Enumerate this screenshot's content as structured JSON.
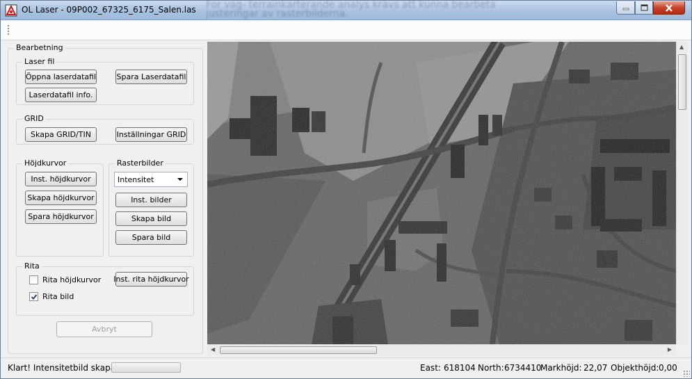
{
  "window": {
    "title": "OL Laser - 09P002_67325_6175_Salen.las",
    "background_text_line1": "För väg- terrainkarterande analys krävs att kunna bearbeta",
    "background_text_line2": "justeringar av rasterbilderna."
  },
  "panel": {
    "group_title": "Bearbetning",
    "laserfil": {
      "title": "Laser fil",
      "open_label": "Öppna laserdatafil",
      "save_label": "Spara Laserdatafil",
      "info_label": "Laserdatafil info."
    },
    "grid": {
      "title": "GRID",
      "create_label": "Skapa GRID/TIN",
      "settings_label": "Inställningar GRID"
    },
    "hojdkurvor": {
      "title": "Höjdkurvor",
      "settings_label": "Inst. höjdkurvor",
      "create_label": "Skapa höjdkurvor",
      "save_label": "Spara höjdkurvor"
    },
    "rasterbilder": {
      "title": "Rasterbilder",
      "select_value": "Intensitet",
      "settings_label": "Inst. bilder",
      "create_label": "Skapa bild",
      "save_label": "Spara bild"
    },
    "rita": {
      "title": "Rita",
      "draw_contours_label": "Rita höjdkurvor",
      "draw_contours_checked": false,
      "draw_image_label": "Rita bild",
      "draw_image_checked": true,
      "settings_label": "Inst. rita höjdkurvor"
    },
    "cancel_label": "Avbryt"
  },
  "status": {
    "message": "Klart! Intensitetbild skapad.",
    "progress": 0,
    "east_label": "East:",
    "east_value": "618104",
    "north_label": "North:",
    "north_value": "6734410",
    "markhojd_label": "Markhöjd:",
    "markhojd_value": "22,07",
    "objekthojd_label": "Objekthöjd:",
    "objekthojd_value": "0,00"
  },
  "icons": {
    "app": "laser-app-icon",
    "minimize": "minimize-icon",
    "maximize": "maximize-icon",
    "close": "close-icon"
  },
  "colors": {
    "title_bar": "#a9c2df",
    "close_button": "#c7432a",
    "window_bg": "#f0f0f0"
  }
}
